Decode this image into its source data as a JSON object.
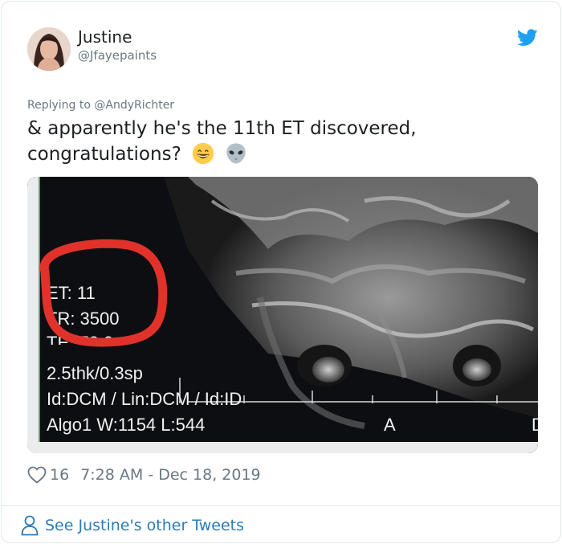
{
  "tweet": {
    "author_name": "Justine",
    "author_handle": "@Jfayepaints",
    "reply_prefix": "Replying to ",
    "reply_to": "@AndyRichter",
    "text_line1": "& apparently he's the 11th ET discovered,",
    "text_line2": "congratulations?",
    "emojis": [
      "grinning-face-emoji",
      "alien-emoji"
    ],
    "likes": "16",
    "timestamp": "7:28 AM - Dec 18, 2019",
    "footer_link": "See Justine's other Tweets"
  },
  "media": {
    "overlay_lines": [
      "ET: 11",
      "TR: 3500",
      "TE: 72.0",
      "2.5thk/0.3sp",
      "Id:DCM / Lin:DCM / Id:ID",
      "Algo1 W:1154  L:544"
    ],
    "marker_a": "A",
    "marker_edge": "D",
    "circle_color": "#e0322a"
  },
  "colors": {
    "brand": "#1da1f2",
    "link": "#2b7bb9",
    "secondary_text": "#697882",
    "border": "#e1e8ed"
  }
}
